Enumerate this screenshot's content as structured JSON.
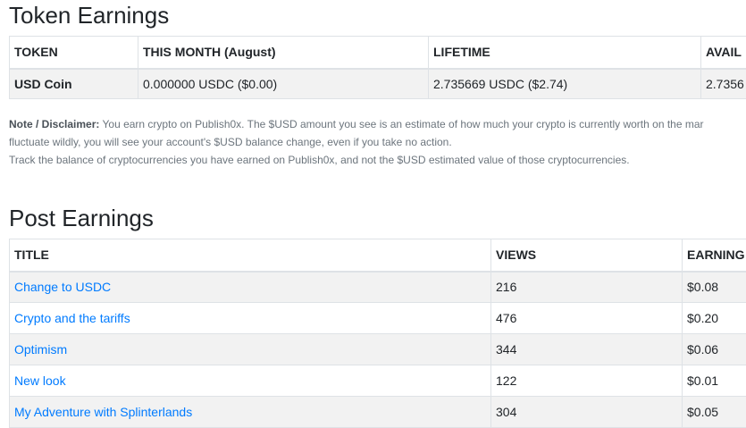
{
  "token_section": {
    "title": "Token Earnings",
    "headers": [
      "TOKEN",
      "THIS MONTH (August)",
      "LIFETIME",
      "AVAIL"
    ],
    "row": {
      "token": "USD Coin",
      "this_month": "0.000000 USDC ($0.00)",
      "lifetime": "2.735669 USDC ($2.74)",
      "available": "2.7356"
    }
  },
  "disclaimer": {
    "label": "Note / Disclaimer:",
    "line1": "You earn crypto on Publish0x. The $USD amount you see is an estimate of how much your crypto is currently worth on the mar",
    "line2": "fluctuate wildly, you will see your account's $USD balance change, even if you take no action.",
    "line3": "Track the balance of cryptocurrencies you have earned on Publish0x, and not the $USD estimated value of those cryptocurrencies."
  },
  "post_section": {
    "title": "Post Earnings",
    "headers": [
      "TITLE",
      "VIEWS",
      "EARNING"
    ],
    "rows": [
      {
        "title": "Change to USDC",
        "views": "216",
        "earnings": "$0.08"
      },
      {
        "title": "Crypto and the tariffs",
        "views": "476",
        "earnings": "$0.20"
      },
      {
        "title": "Optimism",
        "views": "344",
        "earnings": "$0.06"
      },
      {
        "title": "New look",
        "views": "122",
        "earnings": "$0.01"
      },
      {
        "title": "My Adventure with Splinterlands",
        "views": "304",
        "earnings": "$0.05"
      }
    ]
  },
  "colors": {
    "link": "#007bff",
    "stripe": "#f2f2f2",
    "border": "#dee2e6",
    "muted": "#6c757d"
  }
}
